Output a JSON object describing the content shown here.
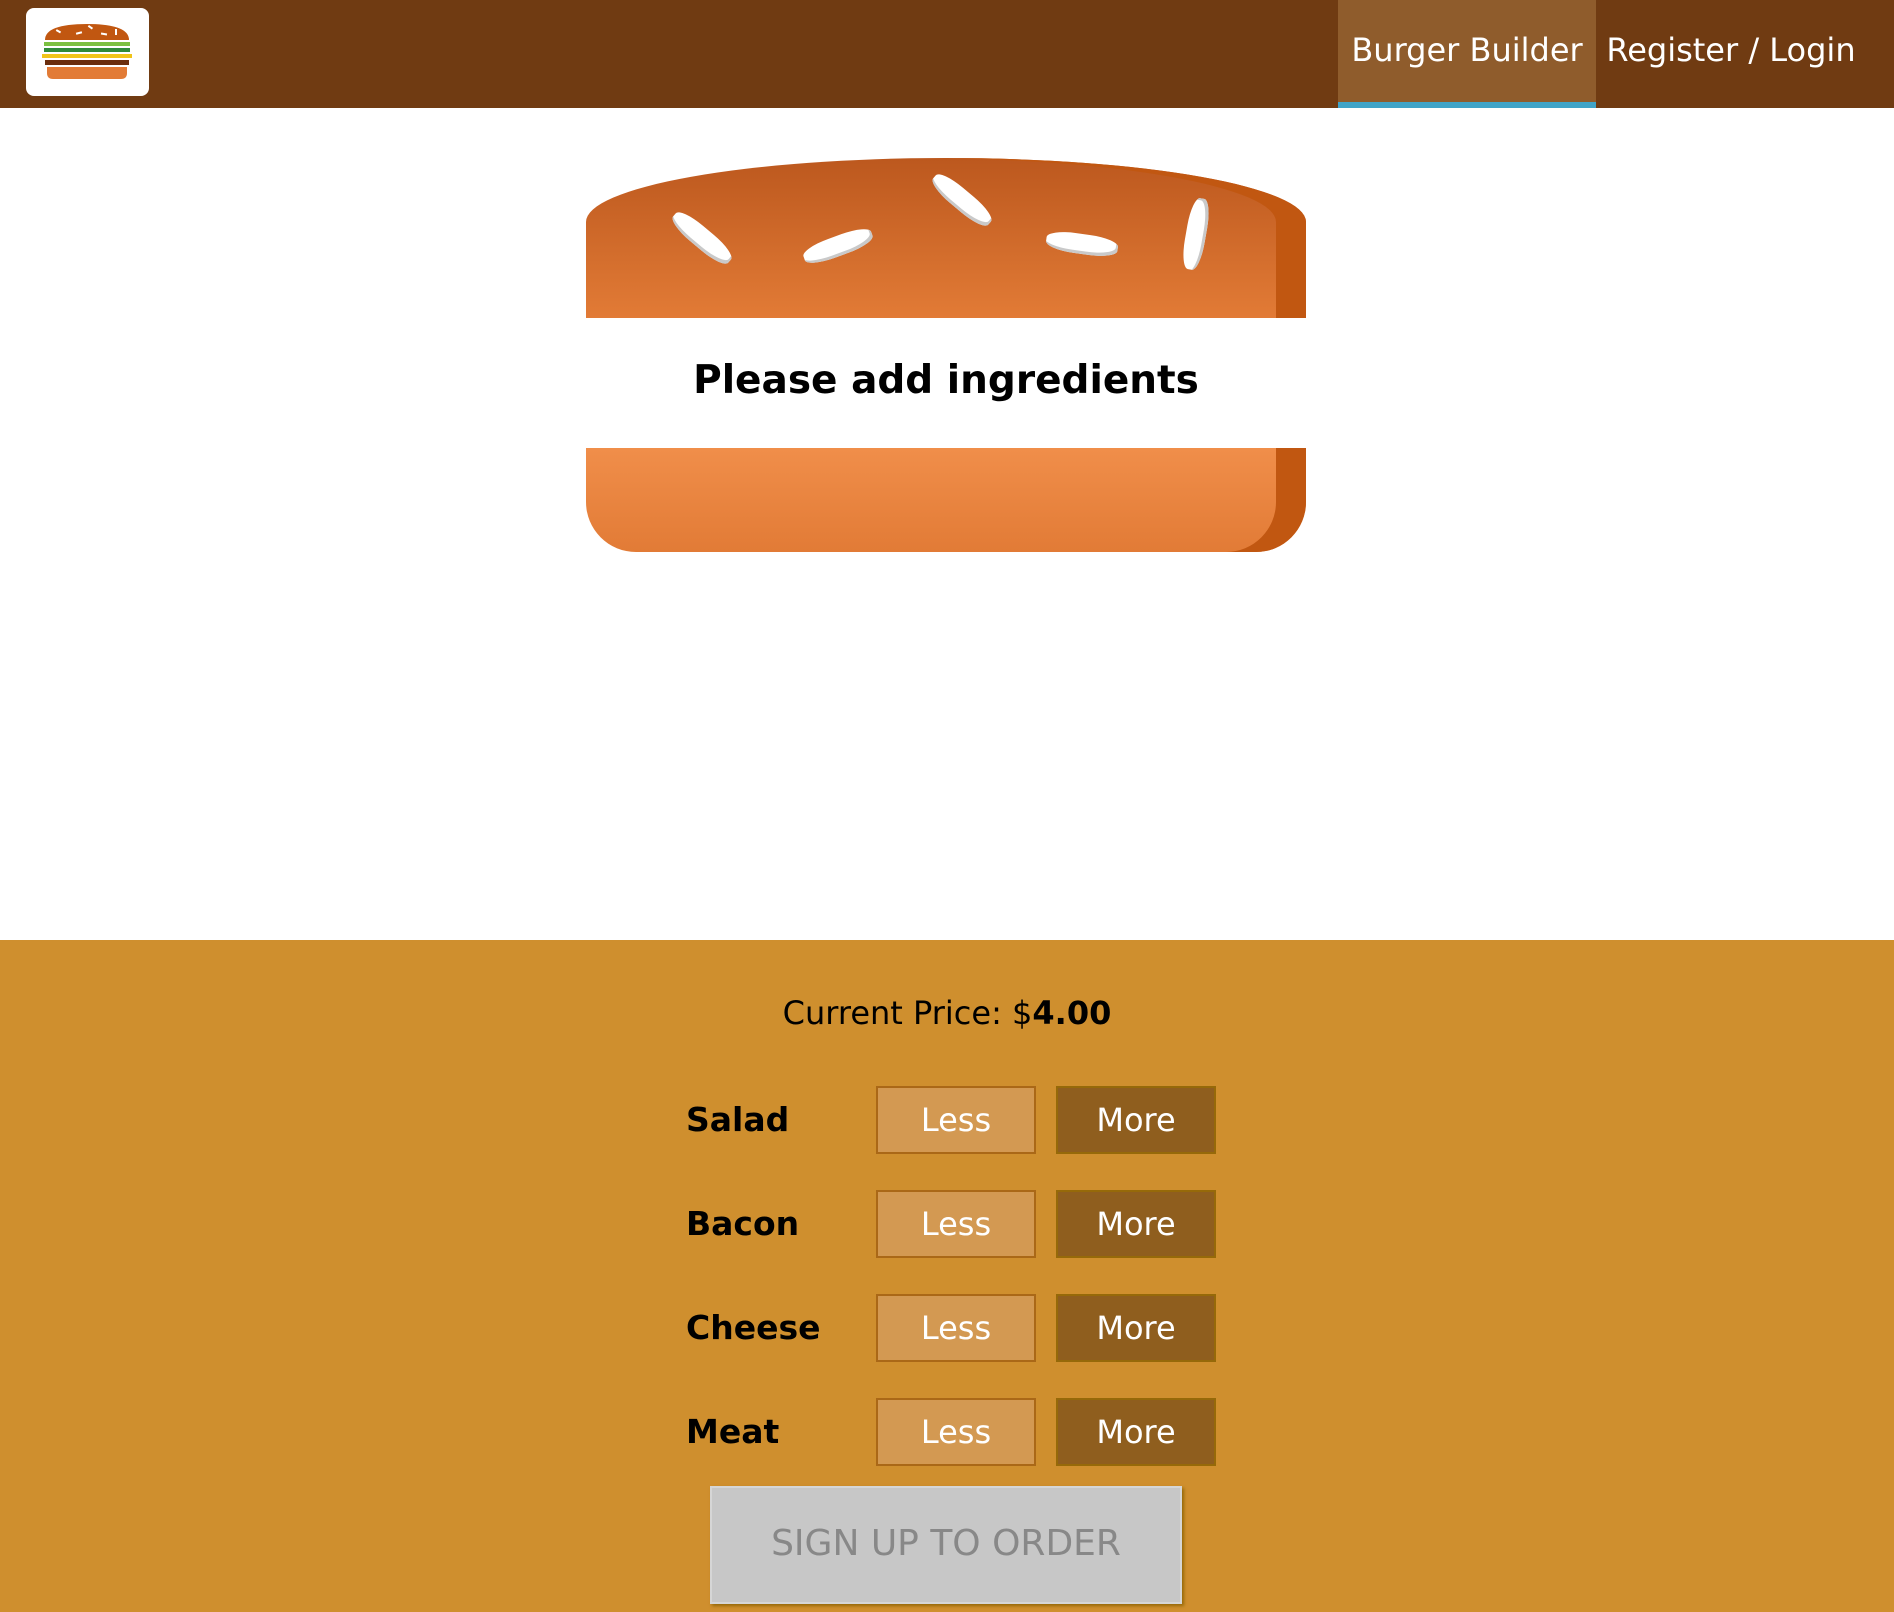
{
  "colors": {
    "toolbar": "#703b12",
    "nav_active": "#8f5c2c",
    "nav_active_underline": "#40a4c8",
    "controls_background": "#cf8f2e",
    "less_button": "#d39952",
    "more_button": "#8f5e1e",
    "order_button_disabled": "#c7c7c7",
    "bread": "#e27b36"
  },
  "toolbar": {
    "logo_icon": "burger-logo-icon",
    "nav": [
      {
        "label": "Burger Builder",
        "active": true
      },
      {
        "label": "Register / Login",
        "active": false
      }
    ]
  },
  "burger": {
    "message": "Please add ingredients"
  },
  "controls": {
    "price_label": "Current Price: $",
    "price_value": "4.00",
    "ingredients": [
      {
        "label": "Salad",
        "less": "Less",
        "more": "More"
      },
      {
        "label": "Bacon",
        "less": "Less",
        "more": "More"
      },
      {
        "label": "Cheese",
        "less": "Less",
        "more": "More"
      },
      {
        "label": "Meat",
        "less": "Less",
        "more": "More"
      }
    ],
    "order_button": "SIGN UP TO ORDER"
  }
}
